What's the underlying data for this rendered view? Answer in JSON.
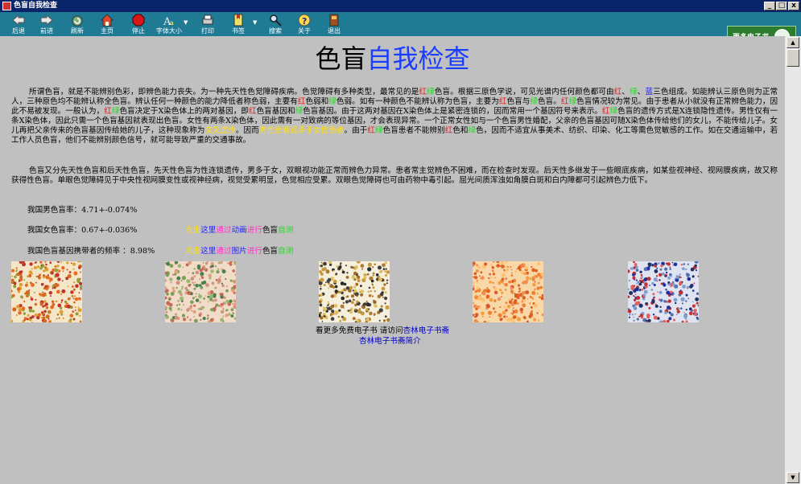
{
  "window": {
    "title": "色盲自我检查",
    "controls": [
      "_",
      "□",
      "x"
    ]
  },
  "toolbar": {
    "buttons": [
      {
        "label": "后退",
        "icon": "back-icon"
      },
      {
        "label": "前进",
        "icon": "forward-icon"
      },
      {
        "label": "刷新",
        "icon": "refresh-icon"
      },
      {
        "label": "主页",
        "icon": "home-icon"
      },
      {
        "label": "停止",
        "icon": "stop-icon"
      },
      {
        "label": "字体大小",
        "icon": "font-size-icon"
      },
      {
        "label": "打印",
        "icon": "print-icon"
      },
      {
        "label": "书签",
        "icon": "bookmark-icon"
      },
      {
        "label": "搜索",
        "icon": "search-icon"
      },
      {
        "label": "关于",
        "icon": "help-icon"
      },
      {
        "label": "退出",
        "icon": "exit-icon"
      }
    ],
    "brand": "更多电子书"
  },
  "page": {
    "heading_black": "色盲",
    "heading_blue": "自我检查",
    "p1": [
      {
        "t": "所谓色盲，就是不能辨别色彩，即辨色能力丧失。为一种先天性色觉障碍疾病。色觉障碍有多种类型，最常见的是"
      },
      {
        "t": "红",
        "c": "r"
      },
      {
        "t": "绿",
        "c": "g"
      },
      {
        "t": "色盲。根据三原色学说，可见光谱内任何颜色都可由"
      },
      {
        "t": "红",
        "c": "r"
      },
      {
        "t": "、"
      },
      {
        "t": "绿",
        "c": "g"
      },
      {
        "t": "、"
      },
      {
        "t": "蓝",
        "c": "b"
      },
      {
        "t": "三色组成。如能辨认三原色则为正常人，三种原色均不能辨认称全色盲。辨认任何一种颜色的能力降低者称色弱，主要有"
      },
      {
        "t": "红",
        "c": "r"
      },
      {
        "t": "色弱和"
      },
      {
        "t": "绿",
        "c": "g"
      },
      {
        "t": "色弱。如有一种颜色不能辨认称为色盲，主要为"
      },
      {
        "t": "红",
        "c": "r"
      },
      {
        "t": "色盲与"
      },
      {
        "t": "绿",
        "c": "g"
      },
      {
        "t": "色盲。"
      },
      {
        "t": "红",
        "c": "r"
      },
      {
        "t": "绿",
        "c": "g"
      },
      {
        "t": "色盲情况较为常见。由于患者从小就没有正常辨色能力，因此不易被发现。一般认为，"
      },
      {
        "t": "红",
        "c": "r"
      },
      {
        "t": "绿",
        "c": "g"
      },
      {
        "t": "色盲决定于X染色体上的两对基因，即"
      },
      {
        "t": "红",
        "c": "r"
      },
      {
        "t": "色盲基因和"
      },
      {
        "t": "绿",
        "c": "g"
      },
      {
        "t": "色盲基因。由于这两对基因在X染色体上是紧密连锁的，因而常用一个基因符号来表示。"
      },
      {
        "t": "红",
        "c": "r"
      },
      {
        "t": "绿",
        "c": "g"
      },
      {
        "t": "色盲的遗传方式是X连锁隐性遗传。男性仅有一条X染色体，因此只需一个色盲基因就表现出色盲。女性有两条X染色体，因此需有一对致病的等位基因，才会表现异常。一个正常女性如与一个色盲男性婚配，父亲的色盲基因可随X染色体传给他们的女儿，不能传给儿子。女儿再把父亲传来的色盲基因传给她的儿子，这种现象称为"
      },
      {
        "t": "交叉遗传",
        "c": "y"
      },
      {
        "t": "。因而"
      },
      {
        "t": "男性患者远多于女性患者",
        "c": "y"
      },
      {
        "t": "。由于"
      },
      {
        "t": "红",
        "c": "r"
      },
      {
        "t": "绿",
        "c": "g"
      },
      {
        "t": "色盲患者不能辨别"
      },
      {
        "t": "红",
        "c": "r"
      },
      {
        "t": "色和"
      },
      {
        "t": "绿",
        "c": "g"
      },
      {
        "t": "色，因而不适宜从事美术、纺织、印染、化工等需色觉敏感的工作。如在交通运输中，若工作人员色盲，他们不能辨别颜色信号，就可能导致严重的交通事故。"
      }
    ],
    "p2": "色盲又分先天性色盲和后天性色盲，先天性色盲为性连锁遗传，男多于女，双眼视功能正常而辨色力异常。患者常主觉辨色不困难，而在检查时发现。后天性多继发于一些眼底疾病，如某些视神经、视网膜疾病，故又称获得性色盲。单眼色觉障碍见于中央性视网膜变性或视神经病，视觉受累明显，色觉相应受累。双眼色觉障碍也可由药物中毒引起。屈光间质浑浊如角膜白斑和白内障都可引起辨色力低下。",
    "stat_male": "我国男色盲率：4.71+-0.074%",
    "stat_female": "我国女色盲率：0.67+-0.036%",
    "stat_carrier": "我国色盲基因携带者的频率 ：8.98%",
    "link_anim": [
      {
        "t": "点击",
        "c": "y"
      },
      {
        "t": "这里",
        "c": "b"
      },
      {
        "t": "通过",
        "c": "m"
      },
      {
        "t": "动画",
        "c": "b"
      },
      {
        "t": "进行",
        "c": "m"
      },
      {
        "t": "色盲",
        "c": "k"
      },
      {
        "t": "自测",
        "c": "g"
      }
    ],
    "link_pic": [
      {
        "t": "点击",
        "c": "y"
      },
      {
        "t": "这里",
        "c": "b"
      },
      {
        "t": "通过",
        "c": "m"
      },
      {
        "t": "图片",
        "c": "b"
      },
      {
        "t": "进行",
        "c": "m"
      },
      {
        "t": "色盲",
        "c": "k"
      },
      {
        "t": "自测",
        "c": "g"
      }
    ],
    "plates": [
      {
        "bg": "#f4e6c8",
        "colors": [
          "#d2691e",
          "#e0a030",
          "#c8302a",
          "#8fa040",
          "#e86a20",
          "#b8382e"
        ]
      },
      {
        "bg": "#f0dcc8",
        "colors": [
          "#7aa05a",
          "#c86858",
          "#e0a080",
          "#9ab870",
          "#d09080",
          "#4a8050"
        ]
      },
      {
        "bg": "#f5efdc",
        "colors": [
          "#2a2a2a",
          "#c89a40",
          "#a06a2a",
          "#e0c060",
          "#404040",
          "#b07a30"
        ]
      },
      {
        "bg": "#f8d8a8",
        "colors": [
          "#f08030",
          "#f4a040",
          "#e06020",
          "#ffc070",
          "#f09058",
          "#d85a28"
        ]
      },
      {
        "bg": "#e0e4f0",
        "colors": [
          "#2030a0",
          "#c03030",
          "#80a0d0",
          "#203060",
          "#e06060",
          "#5070b0"
        ]
      }
    ],
    "footer_text": "看更多免费电子书   请访问",
    "footer_link": "杏林电子书斋",
    "footer_intro": "杏林电子书斋简介"
  }
}
